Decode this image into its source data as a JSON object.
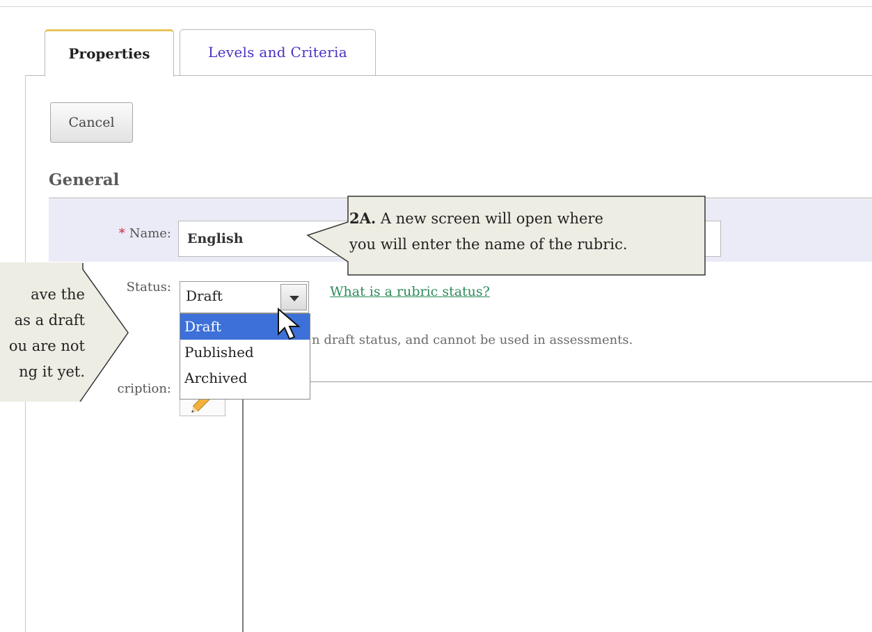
{
  "tabs": [
    {
      "label": "Properties",
      "active": true
    },
    {
      "label": "Levels and Criteria",
      "active": false
    }
  ],
  "toolbar": {
    "cancel_label": "Cancel"
  },
  "section": {
    "title": "General"
  },
  "form": {
    "name_label": "Name:",
    "name_required_mark": "*",
    "name_value": "English",
    "status_label": "Status:",
    "status_value": "Draft",
    "status_options": [
      "Draft",
      "Published",
      "Archived"
    ],
    "status_help_link": "What is a rubric status?",
    "status_note": "n draft status, and cannot be used in assessments.",
    "description_label": "cription:",
    "pencil_icon": "pencil-icon"
  },
  "callouts": {
    "right_bold": "2A.",
    "right_line1": " A new screen will open where",
    "right_line2": "you will enter the name of the rubric.",
    "left_lines": [
      "ave the",
      "as a draft",
      "ou are not",
      "ng it yet."
    ]
  },
  "colors": {
    "tab_active_accent": "#e7c35a",
    "tab_link": "#4b2fc4",
    "required": "#c8223c",
    "name_row_bg": "#ebebf7",
    "option_selected": "#3d70d8",
    "help_link": "#2d8a5b",
    "callout_fill": "#eeede3"
  }
}
